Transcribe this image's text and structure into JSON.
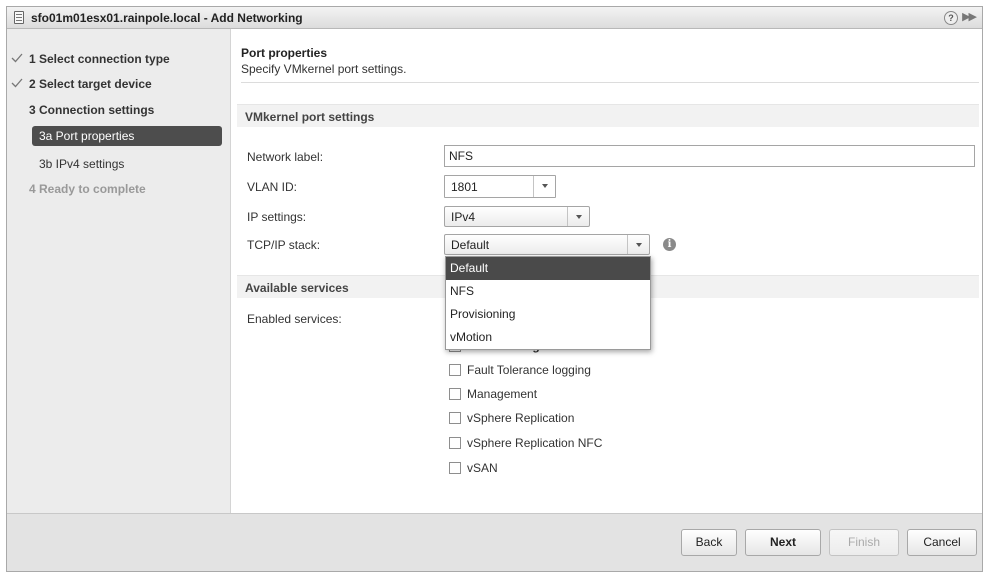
{
  "window": {
    "title": "sfo01m01esx01.rainpole.local - Add Networking",
    "help_glyph": "?",
    "collapse_glyph": "▶▶"
  },
  "sidebar": {
    "items": [
      {
        "label": "1 Select connection type",
        "state": "completed"
      },
      {
        "label": "2 Select target device",
        "state": "completed"
      },
      {
        "label": "3 Connection settings",
        "state": "current-step"
      },
      {
        "label": "3a Port properties",
        "state": "active"
      },
      {
        "label": "3b IPv4 settings",
        "state": "sub"
      },
      {
        "label": "4 Ready to complete",
        "state": "disabled"
      }
    ]
  },
  "main": {
    "title": "Port properties",
    "subtitle": "Specify VMkernel port settings.",
    "vmkernel_section": "VMkernel port settings",
    "fields": {
      "network_label": {
        "label": "Network label:",
        "value": "NFS"
      },
      "vlan_id": {
        "label": "VLAN ID:",
        "value": "1801"
      },
      "ip_settings": {
        "label": "IP settings:",
        "value": "IPv4"
      },
      "tcpip_stack": {
        "label": "TCP/IP stack:",
        "value": "Default"
      }
    },
    "tcpip_options": [
      "Default",
      "NFS",
      "Provisioning",
      "vMotion"
    ],
    "tcpip_selected": "Default",
    "services_section": "Available services",
    "enabled_services_label": "Enabled services:",
    "hidden_service_fragment": "Provisioning",
    "services": [
      {
        "label": "Fault Tolerance logging",
        "checked": false
      },
      {
        "label": "Management",
        "checked": false
      },
      {
        "label": "vSphere Replication",
        "checked": false
      },
      {
        "label": "vSphere Replication NFC",
        "checked": false
      },
      {
        "label": "vSAN",
        "checked": false
      }
    ]
  },
  "footer": {
    "back": "Back",
    "next": "Next",
    "finish": "Finish",
    "cancel": "Cancel"
  },
  "colors": {
    "active_nav": "#4d4d4d",
    "dropdown_selected": "#4a4a4a",
    "sidebar_bg": "#ececec",
    "footer_bg": "#e3e3e3"
  }
}
